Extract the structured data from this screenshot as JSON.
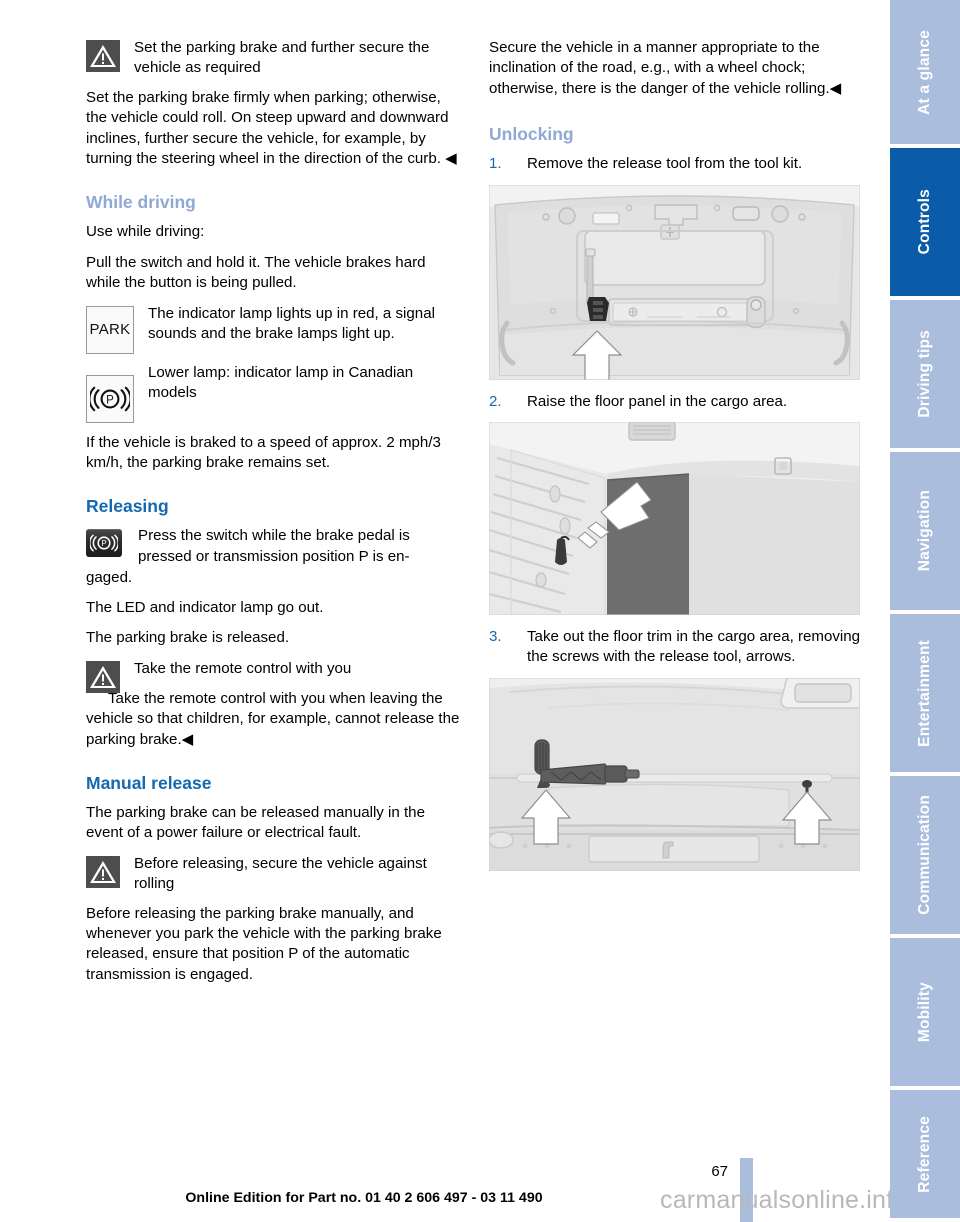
{
  "document": {
    "page_number": "67",
    "footer_text": "Online Edition for Part no. 01 40 2 606 497 - 03 11 490",
    "watermark": "carmanualsonline.info"
  },
  "sidebar": {
    "tabs": [
      {
        "label": "At a glance",
        "active": false
      },
      {
        "label": "Controls",
        "active": true
      },
      {
        "label": "Driving tips",
        "active": false
      },
      {
        "label": "Navigation",
        "active": false
      },
      {
        "label": "Entertainment",
        "active": false
      },
      {
        "label": "Communication",
        "active": false
      },
      {
        "label": "Mobility",
        "active": false
      },
      {
        "label": "Reference",
        "active": false
      }
    ],
    "active_color": "#0b5ca8",
    "inactive_color": "#aabddd"
  },
  "left_column": {
    "warning_1": {
      "icon": "warning-triangle-icon",
      "title": "Set the parking brake and further secure the vehicle as required",
      "body": "Set the parking brake firmly when parking; otherwise, the vehicle could roll. On steep upward and downward inclines, further secure the vehicle, for example, by turning the steering wheel in the direction of the curb. ◀"
    },
    "heading_while_driving": "While driving",
    "para_use_while_driving": "Use while driving:",
    "para_pull_switch": "Pull the switch and hold it. The vehicle brakes hard while the button is being pulled.",
    "icon_note_park": {
      "icon": "park-indicator-icon",
      "icon_text": "PARK",
      "text": "The indicator lamp lights up in red, a signal sounds and the brake lamps light up."
    },
    "icon_note_canadian": {
      "icon": "parking-brake-lamp-icon",
      "text": "Lower lamp: indicator lamp in Canadian models"
    },
    "para_braked_speed": "If the vehicle is braked to a speed of approx. 2 mph/3 km/h, the parking brake remains set.",
    "heading_releasing": "Releasing",
    "icon_note_switch": {
      "icon": "parking-brake-switch-icon",
      "text": "Press the switch while the brake pedal is pressed or transmission position P is engaged.",
      "text_indent": "Press the switch while the brake pedal is pressed or transmission position P is en-",
      "text_run_on": "gaged."
    },
    "para_led_out": "The LED and indicator lamp go out.",
    "para_released": "The parking brake is released.",
    "warning_2": {
      "icon": "warning-triangle-icon",
      "title": "Take the remote control with you",
      "body_indent": "Take the remote control with you when",
      "body": "Take the remote control with you when leaving the vehicle so that children, for example, cannot release the parking brake.◀"
    },
    "heading_manual_release": "Manual release",
    "para_manual_release": "The parking brake can be released manually in the event of a power failure or electrical fault.",
    "warning_3": {
      "icon": "warning-triangle-icon",
      "title": "Before releasing, secure the vehicle against rolling",
      "body": "Before releasing the parking brake manually, and whenever you park the vehicle with the parking brake released, ensure that position P of the automatic transmission is engaged."
    }
  },
  "right_column": {
    "para_secure_vehicle": "Secure the vehicle in a manner appropriate to the inclination of the road, e.g., with a wheel chock; otherwise, there is the danger of the vehicle rolling.◀",
    "heading_unlocking": "Unlocking",
    "steps": [
      {
        "num": "1.",
        "text": "Remove the release tool from the tool kit."
      },
      {
        "num": "2.",
        "text": "Raise the floor panel in the cargo area."
      },
      {
        "num": "3.",
        "text": "Take out the floor trim in the cargo area, removing the screws with the release tool, arrows."
      }
    ],
    "figures": [
      {
        "name": "figure-trunk-lid-tool-location",
        "caption": ""
      },
      {
        "name": "figure-cargo-floor-panel-raise",
        "caption": ""
      },
      {
        "name": "figure-cargo-floor-trim-screws",
        "caption": ""
      }
    ]
  },
  "colors": {
    "heading_blue": "#1569b0",
    "heading_muted_blue": "#8fa9d4",
    "step_number_blue": "#1569b0",
    "warning_icon_bg": "#4d4d4d"
  }
}
